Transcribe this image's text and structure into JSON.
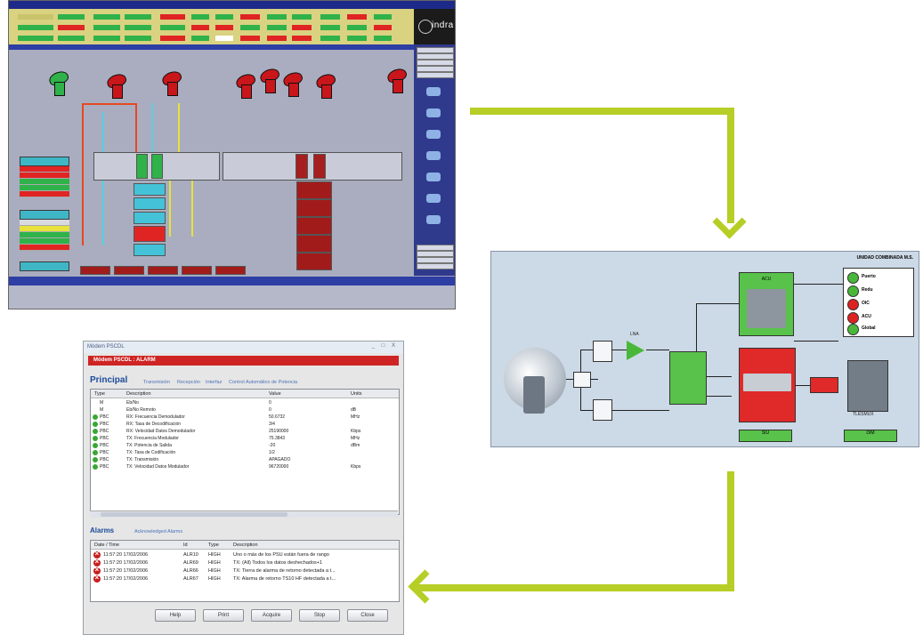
{
  "screen1": {
    "logo_text": "indra",
    "side_headers": [
      "",
      "",
      ""
    ]
  },
  "screen2": {
    "title": "UNIDAD COMBINADA M.S.",
    "blocks": {
      "acu": "ACU",
      "main_red": "",
      "mid_green": "",
      "small_red": "",
      "box_left": "",
      "filter_top": "",
      "filter_bottom": "",
      "lna": "LNA",
      "bottom_left": "SIU",
      "bottom_right": "DIM",
      "device_label": "TLESMUX"
    },
    "legend": [
      {
        "label": "Puerto",
        "color": "#49b83a"
      },
      {
        "label": "Redu",
        "color": "#49b83a"
      },
      {
        "label": "OIC",
        "color": "#d22"
      },
      {
        "label": "ACU",
        "color": "#d22"
      },
      {
        "label": "Global",
        "color": "#49b83a"
      }
    ]
  },
  "screen3": {
    "window_title": "Módem PSCDL",
    "window_buttons": "_ □ X",
    "red_header": "Módem PSCDL : ALARM",
    "tab_main": "Principal",
    "tabs": [
      "Transmisión",
      "Recepción",
      "Interfaz",
      "Control Automático de Potencia"
    ],
    "columns": [
      "Type",
      "Description",
      "Value",
      "Units"
    ],
    "rows": [
      {
        "type": "M",
        "desc": "Eb/No",
        "value": "0",
        "units": ""
      },
      {
        "type": "M",
        "desc": "Eb/No Remoto",
        "value": "0",
        "units": "dB"
      },
      {
        "type": "PBC",
        "desc": "RX: Frecuencia Demodulador",
        "value": "50.6732",
        "units": "MHz"
      },
      {
        "type": "PBC",
        "desc": "RX: Tasa de Decodificación",
        "value": "3/4",
        "units": ""
      },
      {
        "type": "PBC",
        "desc": "RX: Velocidad Datos Demodulador",
        "value": "25190000",
        "units": "Kbps"
      },
      {
        "type": "PBC",
        "desc": "TX: Frecuencia Modulador",
        "value": "75.3843",
        "units": "MHz"
      },
      {
        "type": "PBC",
        "desc": "TX: Potencia de Salida",
        "value": "-20",
        "units": "dBm"
      },
      {
        "type": "PBC",
        "desc": "TX: Tasa de Codificación",
        "value": "1/2",
        "units": ""
      },
      {
        "type": "PBC",
        "desc": "TX: Transmisión",
        "value": "APAGADO",
        "units": ""
      },
      {
        "type": "PBC",
        "desc": "TX: Velocidad Datos Modulador",
        "value": "96720000",
        "units": "Kbps"
      }
    ],
    "alarms_tab": "Alarms",
    "alarms_tab2": "Acknowledged Alarms",
    "alarm_columns": [
      "Date / Time",
      "Id",
      "Type",
      "Description"
    ],
    "alarms": [
      {
        "datetime": "11:57:20 17/02/2006",
        "id": "ALR10",
        "type": "HIGH",
        "desc": "Uno o más de los PSU están fuera de rango"
      },
      {
        "datetime": "11:57:20 17/02/2006",
        "id": "ALR69",
        "type": "HIGH",
        "desc": "TX: (All) Todos los datos deshechados+1"
      },
      {
        "datetime": "11:57:20 17/02/2006",
        "id": "ALR66",
        "type": "HIGH",
        "desc": "TX: Tierra de alarma de retorno detectada a t..."
      },
      {
        "datetime": "11:57:20 17/02/2006",
        "id": "ALR67",
        "type": "HIGH",
        "desc": "TX: Alarma de retorno TS10 HF detectada a t..."
      }
    ],
    "buttons": [
      "Help",
      "Print",
      "Acquire",
      "Stop",
      "Close"
    ]
  }
}
